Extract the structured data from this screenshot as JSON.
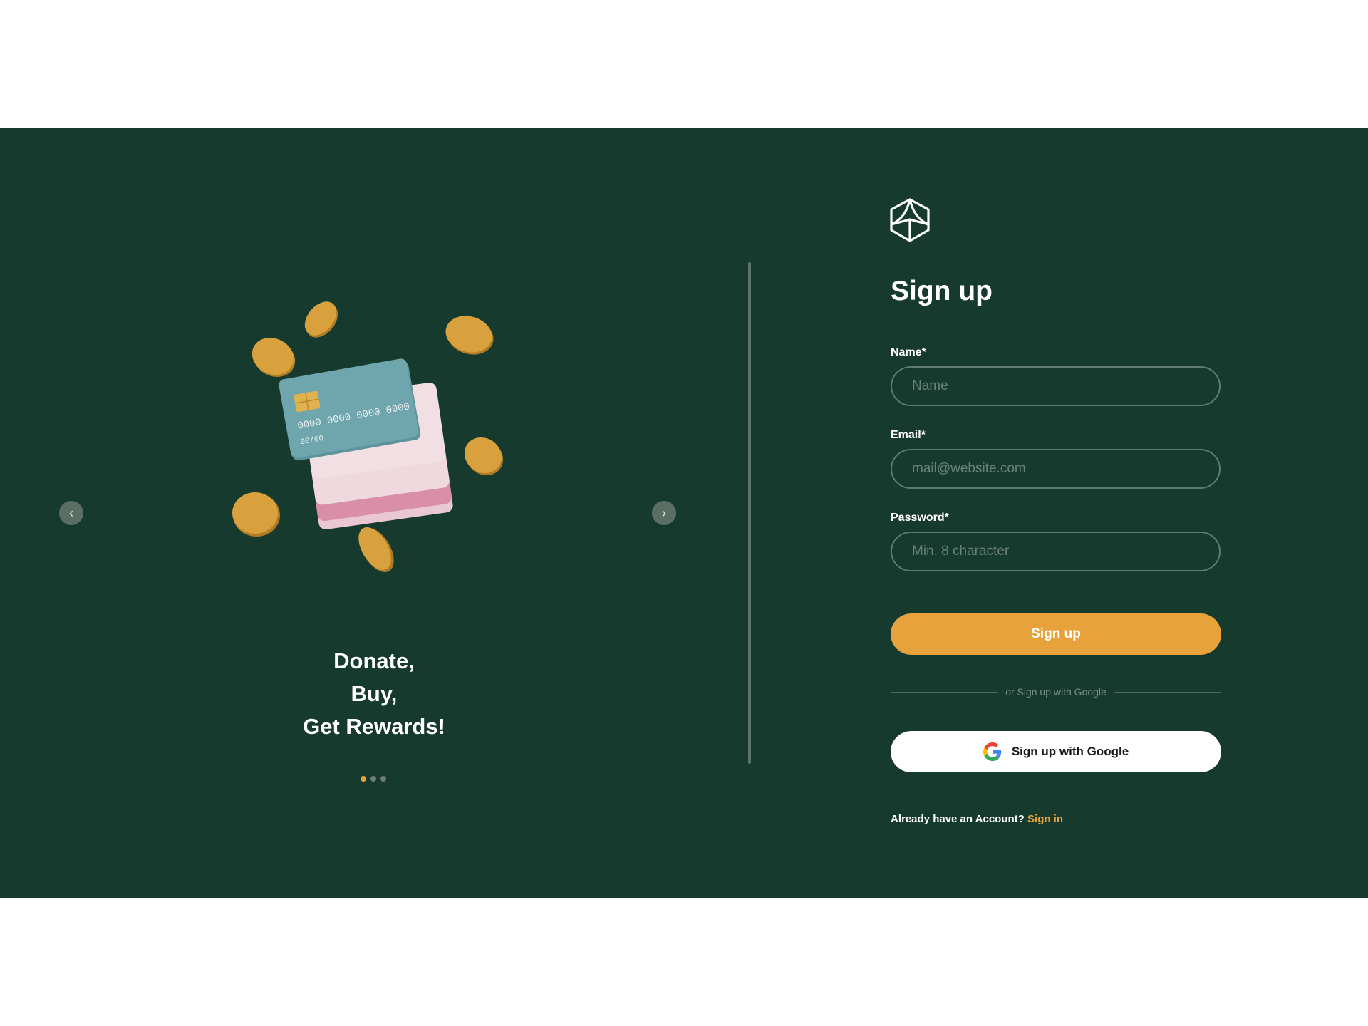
{
  "carousel": {
    "prev_symbol": "‹",
    "next_symbol": "›",
    "illustration": "credit-cards-with-coins",
    "tagline": [
      "Donate,",
      "Buy,",
      "Get Rewards!"
    ],
    "card_number": "0000 0000 0000 0000",
    "card_expiry": "00/00",
    "slide_count": 3,
    "active_slide": 1
  },
  "form": {
    "logo_icon": "cube-leaf-logo-icon",
    "title": "Sign up",
    "fields": {
      "name": {
        "label": "Name*",
        "placeholder": "Name",
        "value": ""
      },
      "email": {
        "label": "Email*",
        "placeholder": "mail@website.com",
        "value": ""
      },
      "password": {
        "label": "Password*",
        "placeholder": "Min. 8 character",
        "value": ""
      }
    },
    "submit_label": "Sign up",
    "divider_text": "or Sign up with Google",
    "google_label": "Sign up with Google",
    "google_icon": "google-g-icon",
    "footer_text": "Already have an Account?",
    "footer_link": "Sign in"
  },
  "colors": {
    "background": "#173a2f",
    "accent": "#e8a23c",
    "input_border": "#5f7a70",
    "card_blue": "#6fa5ad",
    "card_pink": "#d98fa8",
    "coin": "#d8a13d"
  }
}
